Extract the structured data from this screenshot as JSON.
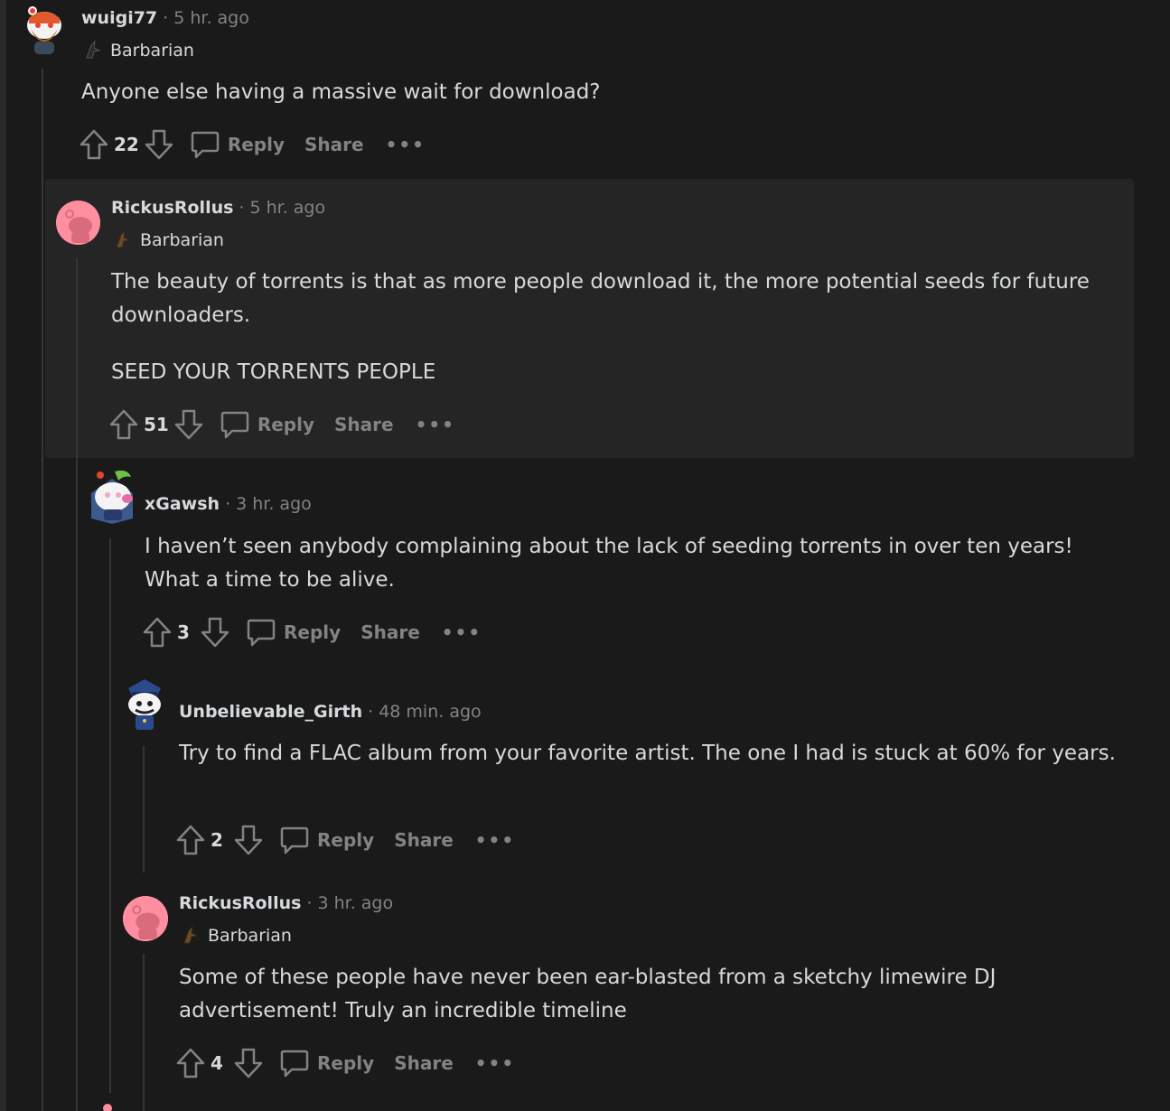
{
  "comments": [
    {
      "username": "wuigi77",
      "time": "5 hr. ago",
      "flair": "Barbarian",
      "body": [
        "Anyone else having a massive wait for download?"
      ],
      "score": "22",
      "reply_label": "Reply",
      "share_label": "Share",
      "more_label": "•••"
    },
    {
      "username": "RickusRollus",
      "time": "5 hr. ago",
      "flair": "Barbarian",
      "body": [
        "The beauty of torrents is that as more people download it, the more potential seeds for future downloaders.",
        "SEED YOUR TORRENTS PEOPLE"
      ],
      "score": "51",
      "reply_label": "Reply",
      "share_label": "Share",
      "more_label": "•••"
    },
    {
      "username": "xGawsh",
      "time": "3 hr. ago",
      "body": [
        "I haven’t seen anybody complaining about the lack of seeding torrents in over ten years! What a time to be alive."
      ],
      "score": "3",
      "reply_label": "Reply",
      "share_label": "Share",
      "more_label": "•••"
    },
    {
      "username": "Unbelievable_Girth",
      "time": "48 min. ago",
      "body": [
        "Try to find a FLAC album from your favorite artist. The one I had is stuck at 60% for years."
      ],
      "score": "2",
      "reply_label": "Reply",
      "share_label": "Share",
      "more_label": "•••"
    },
    {
      "username": "RickusRollus",
      "time": "3 hr. ago",
      "flair": "Barbarian",
      "body": [
        "Some of these people have never been ear-blasted from a sketchy limewire DJ advertisement! Truly an incredible timeline"
      ],
      "score": "4",
      "reply_label": "Reply",
      "share_label": "Share",
      "more_label": "•••"
    }
  ],
  "separator": "·",
  "colors": {
    "background": "#1a1a1b",
    "highlight": "#252526",
    "text": "#d7dadc",
    "muted": "#818384",
    "thread_line": "#343536",
    "avatar_pink": "#ff8fa0"
  }
}
